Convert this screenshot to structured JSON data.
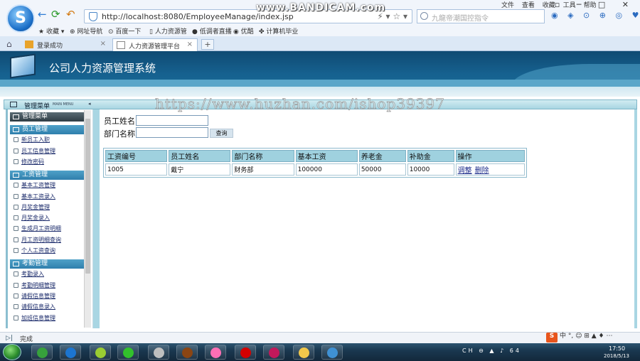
{
  "browser": {
    "watermark": "www.BANDICAM.com",
    "url": "http://localhost:8080/EmployeeManage/index.jsp",
    "search_placeholder": "九龍帝潮国控指令",
    "menu": [
      "文件",
      "查看",
      "收藏",
      "工具",
      "帮助"
    ],
    "window_controls": "▫ ─ □ ✕",
    "favorites": [
      "收藏",
      "网址导航",
      "百度一下",
      "人力资源管",
      "低调者直播",
      "优酷",
      "计算机毕业"
    ],
    "tabs": [
      {
        "label": "登录成功"
      },
      {
        "label": "人力资源管理平台"
      }
    ],
    "status": "完成"
  },
  "app": {
    "title": "公司人力资源管理系统",
    "url_watermark": "https://www.huzhan.com/ishop39397"
  },
  "sidebar": {
    "title": "管理菜单",
    "title_sub": "MAIN MENU",
    "sections": [
      {
        "label": "管理菜单",
        "dark": true,
        "items": []
      },
      {
        "label": "员工管理",
        "items": [
          "新员工入职",
          "员工信息管理",
          "修改密码"
        ]
      },
      {
        "label": "工资管理",
        "items": [
          "基本工资管理",
          "基本工资录入",
          "月奖金管理",
          "月奖金录入",
          "生成月工资明细",
          "月工资明细查询",
          "个人工资查询"
        ]
      },
      {
        "label": "考勤管理",
        "items": [
          "考勤录入",
          "考勤明细管理",
          "请假信息管理",
          "请假信息录入",
          "加班信息管理"
        ]
      }
    ]
  },
  "form": {
    "name_label": "员工姓名",
    "dept_label": "部门名称",
    "name_value": "",
    "dept_value": "",
    "query_button": "查询"
  },
  "table": {
    "headers": [
      "工资编号",
      "员工姓名",
      "部门名称",
      "基本工资",
      "养老金",
      "补助金",
      "操作"
    ],
    "rows": [
      {
        "id": "1005",
        "name": "戴宁",
        "dept": "财务部",
        "base": "100000",
        "pension": "50000",
        "subsidy": "10000",
        "actions": [
          "调整",
          "删除"
        ]
      }
    ]
  },
  "taskbar": {
    "tray_text": "CH ⊖ ▲ ♪ 64",
    "time": "17:50",
    "date": "2018/5/13",
    "apps": [
      {
        "name": "browser-360",
        "color": "#37a13c"
      },
      {
        "name": "sogou-explorer",
        "color": "#1c75d0"
      },
      {
        "name": "ie-green",
        "color": "#9acd32"
      },
      {
        "name": "iqiyi",
        "color": "#32c12c"
      },
      {
        "name": "app-gray",
        "color": "#bfbfbf"
      },
      {
        "name": "app-brown",
        "color": "#8b4513"
      },
      {
        "name": "app-colorful",
        "color": "#ff6fb5"
      },
      {
        "name": "record",
        "color": "#d40000"
      },
      {
        "name": "app-pink",
        "color": "#c2185b"
      },
      {
        "name": "folder",
        "color": "#f1c84b"
      },
      {
        "name": "app-blue",
        "color": "#3f91d4"
      }
    ]
  },
  "ime_text": "中 °, ☺ ⊞ ▲ ♦ ⋯"
}
